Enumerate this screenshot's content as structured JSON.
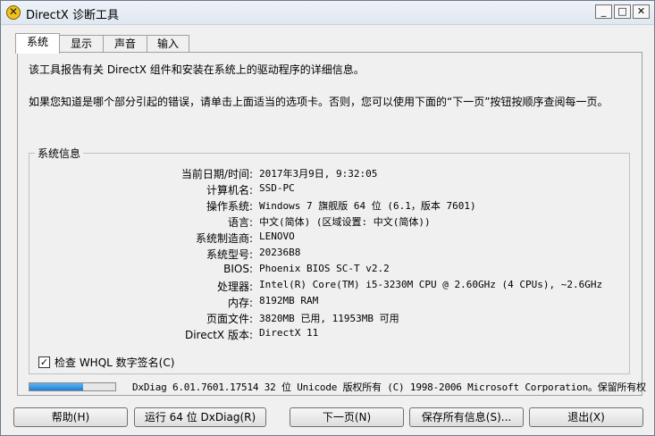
{
  "window": {
    "title": "DirectX 诊断工具"
  },
  "tabs": [
    {
      "label": "系统"
    },
    {
      "label": "显示"
    },
    {
      "label": "声音"
    },
    {
      "label": "输入"
    }
  ],
  "intro": {
    "line1": "该工具报告有关 DirectX 组件和安装在系统上的驱动程序的详细信息。",
    "line2": "如果您知道是哪个部分引起的错误，请单击上面适当的选项卡。否则，您可以使用下面的“下一页”按钮按顺序查阅每一页。"
  },
  "system_info": {
    "legend": "系统信息",
    "rows": [
      {
        "key": "当前日期/时间:",
        "value": "2017年3月9日, 9:32:05"
      },
      {
        "key": "计算机名:",
        "value": "SSD-PC"
      },
      {
        "key": "操作系统:",
        "value": "Windows 7 旗舰版 64 位 (6.1，版本 7601)"
      },
      {
        "key": "语言:",
        "value": "中文(简体) (区域设置: 中文(简体))"
      },
      {
        "key": "系统制造商:",
        "value": "LENOVO"
      },
      {
        "key": "系统型号:",
        "value": "20236B8"
      },
      {
        "key": "BIOS:",
        "value": "Phoenix BIOS SC-T v2.2"
      },
      {
        "key": "处理器:",
        "value": "Intel(R) Core(TM) i5-3230M CPU @ 2.60GHz (4 CPUs), ~2.6GHz"
      },
      {
        "key": "内存:",
        "value": "8192MB RAM"
      },
      {
        "key": "页面文件:",
        "value": "3820MB 已用, 11953MB 可用"
      },
      {
        "key": "DirectX 版本:",
        "value": "DirectX 11"
      }
    ]
  },
  "whql_checkbox": {
    "label": "检查 WHQL 数字签名(C)",
    "checked_mark": "✓"
  },
  "progress": {
    "fraction": 0.62
  },
  "footer": {
    "text": "DxDiag 6.01.7601.17514 32 位 Unicode 版权所有 (C) 1998-2006 Microsoft Corporation。保留所有权"
  },
  "buttons": {
    "help": "帮助(H)",
    "run64": "运行 64 位 DxDiag(R)",
    "next": "下一页(N)",
    "save": "保存所有信息(S)...",
    "exit": "退出(X)"
  },
  "titlebar_buttons": {
    "minimize": "_",
    "maximize": "□",
    "close": "✕"
  }
}
